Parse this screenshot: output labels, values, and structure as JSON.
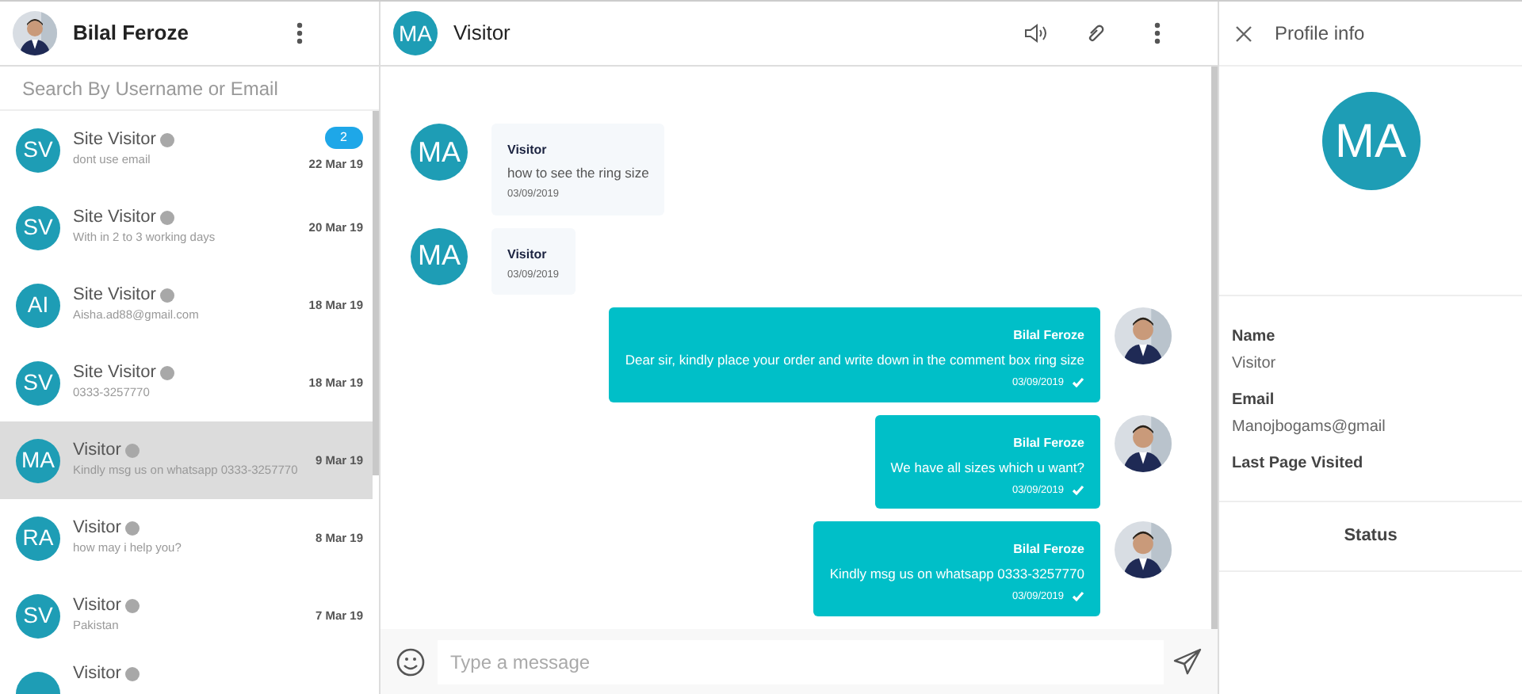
{
  "user": {
    "name": "Bilal Feroze"
  },
  "search": {
    "placeholder": "Search By Username or Email"
  },
  "conversations": [
    {
      "initials": "SV",
      "name": "Site Visitor",
      "online": false,
      "preview": "dont use email",
      "date": "22 Mar 19",
      "unread": "2",
      "selected": false
    },
    {
      "initials": "SV",
      "name": "Site Visitor",
      "online": false,
      "preview": "With in 2 to 3 working days",
      "date": "20 Mar 19",
      "selected": false
    },
    {
      "initials": "AI",
      "name": "Site Visitor",
      "online": false,
      "preview": "Aisha.ad88@gmail.com",
      "date": "18 Mar 19",
      "selected": false
    },
    {
      "initials": "SV",
      "name": "Site Visitor",
      "online": false,
      "preview": "0333-3257770",
      "date": "18 Mar 19",
      "selected": false
    },
    {
      "initials": "MA",
      "name": "Visitor",
      "online": false,
      "preview": "Kindly msg us on whatsapp 0333-3257770",
      "date": "9 Mar 19",
      "selected": true
    },
    {
      "initials": "RA",
      "name": "Visitor",
      "online": false,
      "preview": "how may i help you?",
      "date": "8 Mar 19",
      "selected": false
    },
    {
      "initials": "SV",
      "name": "Visitor",
      "online": false,
      "preview": "Pakistan",
      "date": "7 Mar 19",
      "selected": false
    },
    {
      "name": "Visitor",
      "online": false,
      "selected": false
    }
  ],
  "chat": {
    "initials": "MA",
    "title": "Visitor"
  },
  "messages": [
    {
      "kind": "incoming",
      "initials": "MA",
      "sender": "Visitor",
      "text": "how to see the ring size",
      "time": "03/09/2019"
    },
    {
      "kind": "incoming",
      "initials": "MA",
      "sender": "Visitor",
      "time": "03/09/2019"
    },
    {
      "kind": "outgoing",
      "sender": "Bilal Feroze",
      "text": "Dear sir, kindly place your order and write down in the comment box ring size",
      "time": "03/09/2019",
      "read": true
    },
    {
      "kind": "outgoing",
      "sender": "Bilal Feroze",
      "text": "We have all sizes which u want?",
      "time": "03/09/2019",
      "read": true
    },
    {
      "kind": "outgoing",
      "sender": "Bilal Feroze",
      "text": "Kindly msg us on whatsapp 0333-3257770",
      "time": "03/09/2019",
      "read": true
    }
  ],
  "composer": {
    "placeholder": "Type a message"
  },
  "profile": {
    "title": "Profile info",
    "initials": "MA",
    "fields": [
      {
        "label": "Name",
        "value": "Visitor"
      },
      {
        "label": "Email",
        "value": "Manojbogams@gmail"
      },
      {
        "label": "Last Page Visited"
      }
    ],
    "section": "Status"
  }
}
